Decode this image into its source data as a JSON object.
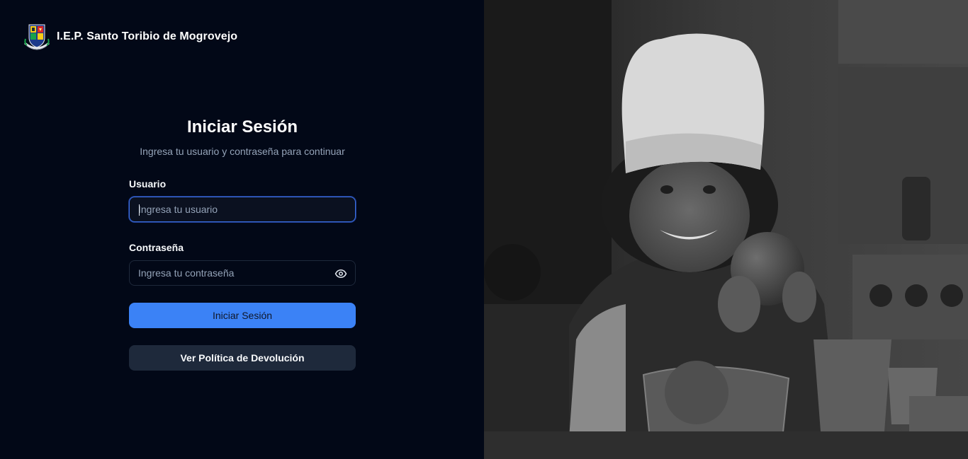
{
  "brand": {
    "name": "I.E.P. Santo Toribio de Mogrovejo"
  },
  "login": {
    "title": "Iniciar Sesión",
    "subtitle": "Ingresa tu usuario y contraseña para continuar",
    "username": {
      "label": "Usuario",
      "placeholder": "Ingresa tu usuario",
      "value": ""
    },
    "password": {
      "label": "Contraseña",
      "placeholder": "Ingresa tu contraseña",
      "value": ""
    },
    "submit_label": "Iniciar Sesión",
    "policy_label": "Ver Política de Devolución"
  },
  "icons": {
    "logo": "school-crest-icon",
    "password_toggle": "eye-icon"
  },
  "colors": {
    "background": "#020817",
    "primary": "#3b82f6",
    "secondary": "#1e293b",
    "focus_border": "#3b6fe0",
    "muted_text": "#94a3b8"
  }
}
